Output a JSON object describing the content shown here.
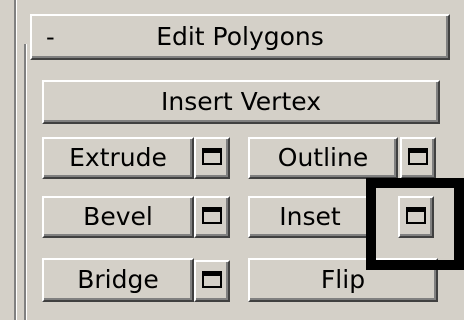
{
  "rollout": {
    "collapse_symbol": "-",
    "title": "Edit Polygons"
  },
  "buttons": {
    "insert_vertex": "Insert Vertex",
    "extrude": "Extrude",
    "outline": "Outline",
    "bevel": "Bevel",
    "inset": "Inset",
    "bridge": "Bridge",
    "flip": "Flip"
  },
  "icons": {
    "settings": "settings-window-icon"
  },
  "colors": {
    "panel_background": "#d4d0c8",
    "highlight_border": "#000000"
  }
}
